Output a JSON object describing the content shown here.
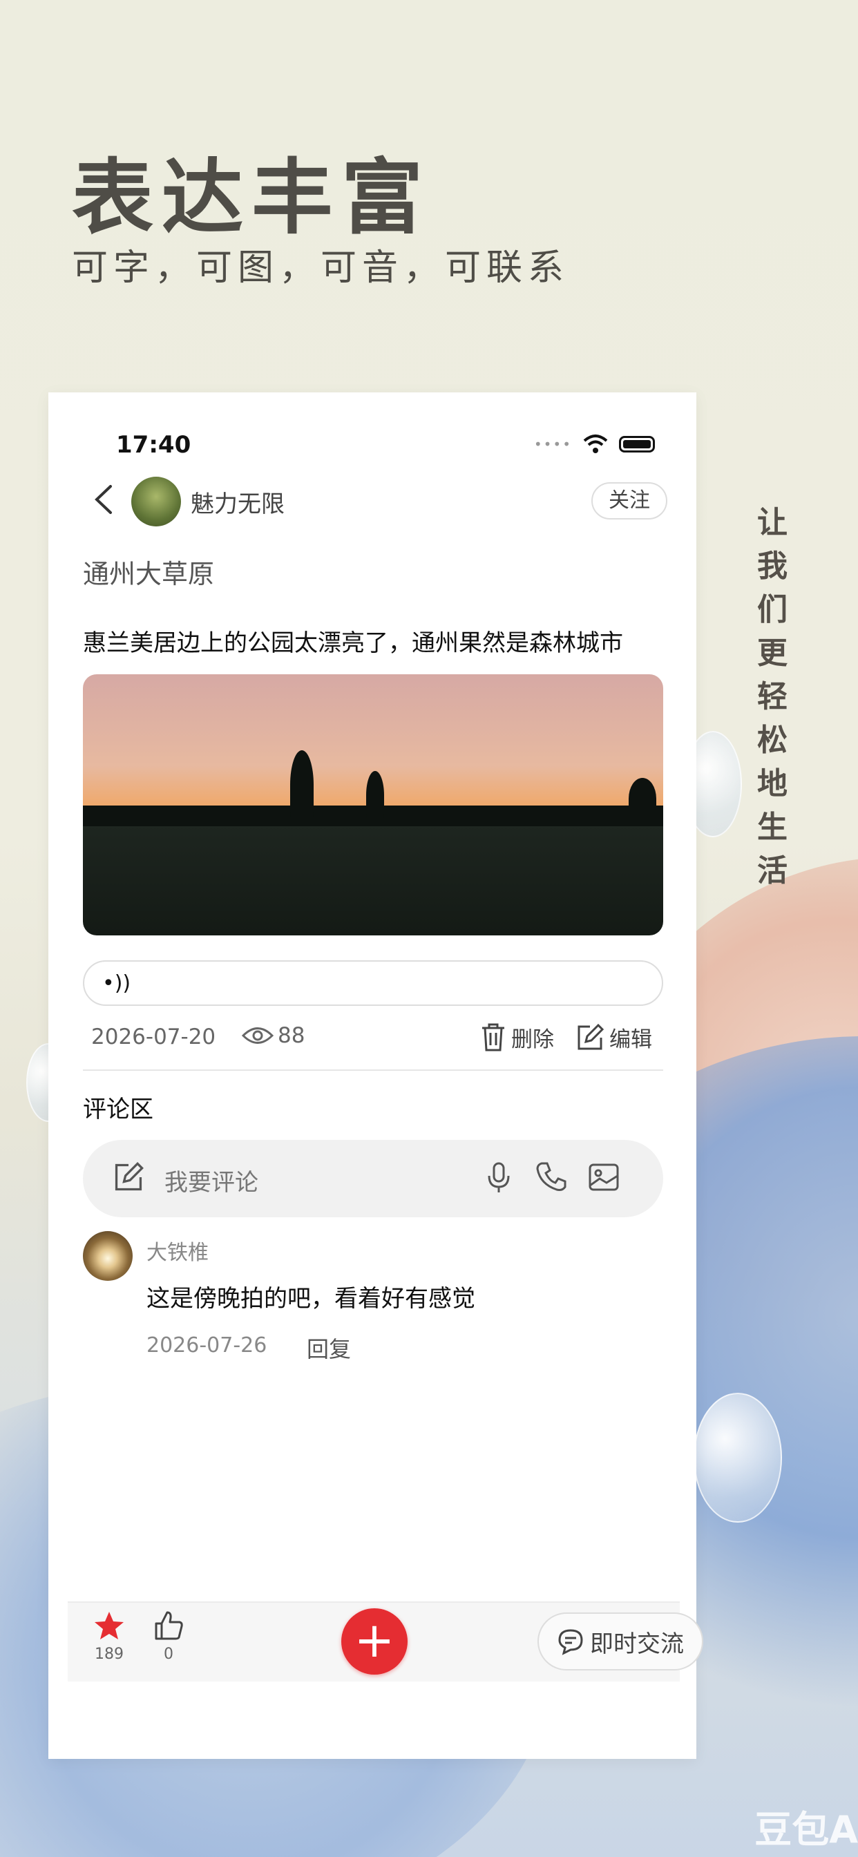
{
  "promo": {
    "headline": "表达丰富",
    "subline": "可字，可图，可音，可联系",
    "vertical_tagline": [
      "让",
      "我",
      "们",
      "更",
      "轻",
      "松",
      "地",
      "生",
      "活"
    ]
  },
  "status_bar": {
    "time": "17:40"
  },
  "nav": {
    "user_name": "魅力无限",
    "follow_label": "关注"
  },
  "post": {
    "title": "通州大草原",
    "content": "惠兰美居边上的公园太漂亮了，通州果然是森林城市",
    "date": "2026-07-20",
    "views": "88",
    "delete_label": "删除",
    "edit_label": "编辑"
  },
  "comments": {
    "header": "评论区",
    "input_placeholder": "我要评论",
    "items": [
      {
        "author": "大铁椎",
        "text": "这是傍晚拍的吧，看着好有感觉",
        "date": "2026-07-26",
        "reply_label": "回复"
      }
    ]
  },
  "bottom_bar": {
    "favorites_count": "189",
    "likes_count": "0",
    "add_label": "+",
    "chat_label": "即时交流"
  },
  "colors": {
    "accent": "#e52d32",
    "star": "#e52d32"
  },
  "watermark": "豆包A"
}
